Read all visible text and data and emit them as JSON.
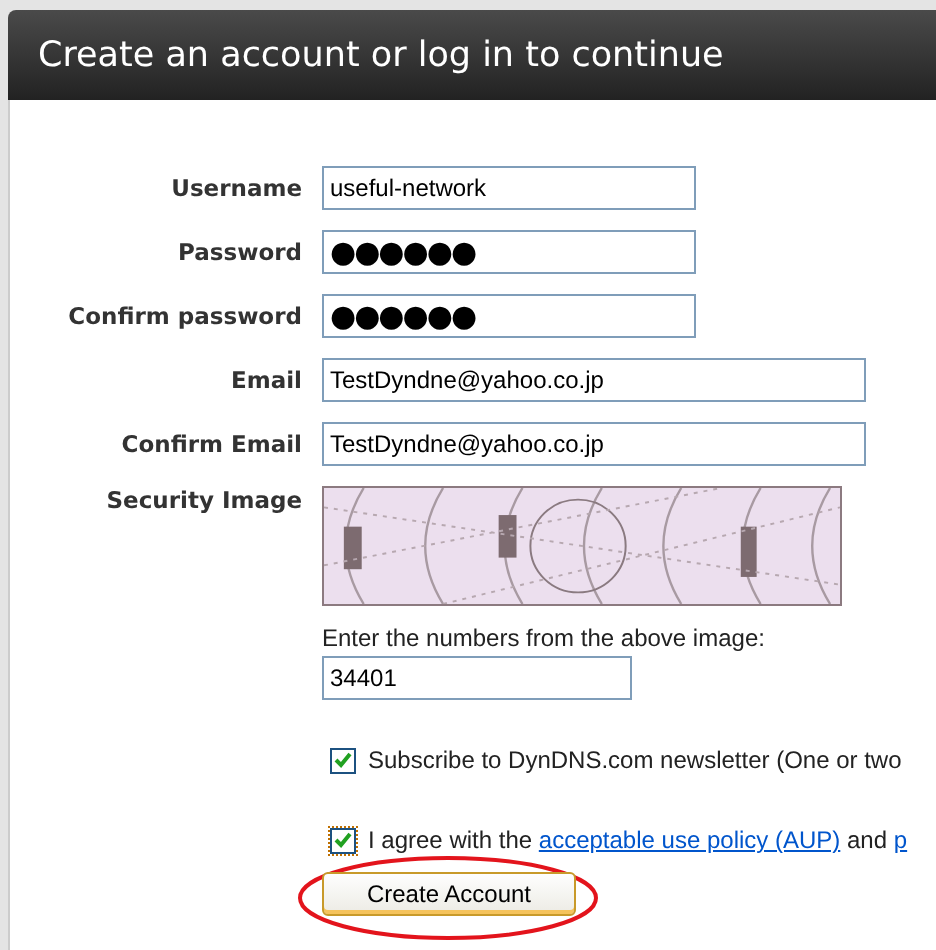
{
  "header": {
    "title": "Create an account or log in to continue"
  },
  "fields": [
    {
      "label": "Username",
      "value": "useful-network",
      "kind": "text"
    },
    {
      "label": "Password",
      "value": "●●●●●●",
      "kind": "password"
    },
    {
      "label": "Confirm password",
      "value": "●●●●●●",
      "kind": "password"
    },
    {
      "label": "Email",
      "value": "TestDyndne@yahoo.co.jp",
      "kind": "email"
    },
    {
      "label": "Confirm Email",
      "value": "TestDyndne@yahoo.co.jp",
      "kind": "email"
    }
  ],
  "security": {
    "label": "Security Image",
    "prompt": "Enter the numbers from the above image:",
    "value": "34401"
  },
  "checkboxes": [
    {
      "parts": [
        {
          "kind": "text",
          "text": "Subscribe to DynDNS.com newsletter (One or two"
        }
      ],
      "checked": true
    },
    {
      "parts": [
        {
          "kind": "text",
          "text": "I agree with the"
        },
        {
          "kind": "link",
          "text": "acceptable use policy (AUP)"
        },
        {
          "kind": "text",
          "text": "and"
        },
        {
          "kind": "link",
          "text": "p"
        }
      ],
      "checked": true
    }
  ],
  "submit": {
    "label": "Create Account"
  }
}
